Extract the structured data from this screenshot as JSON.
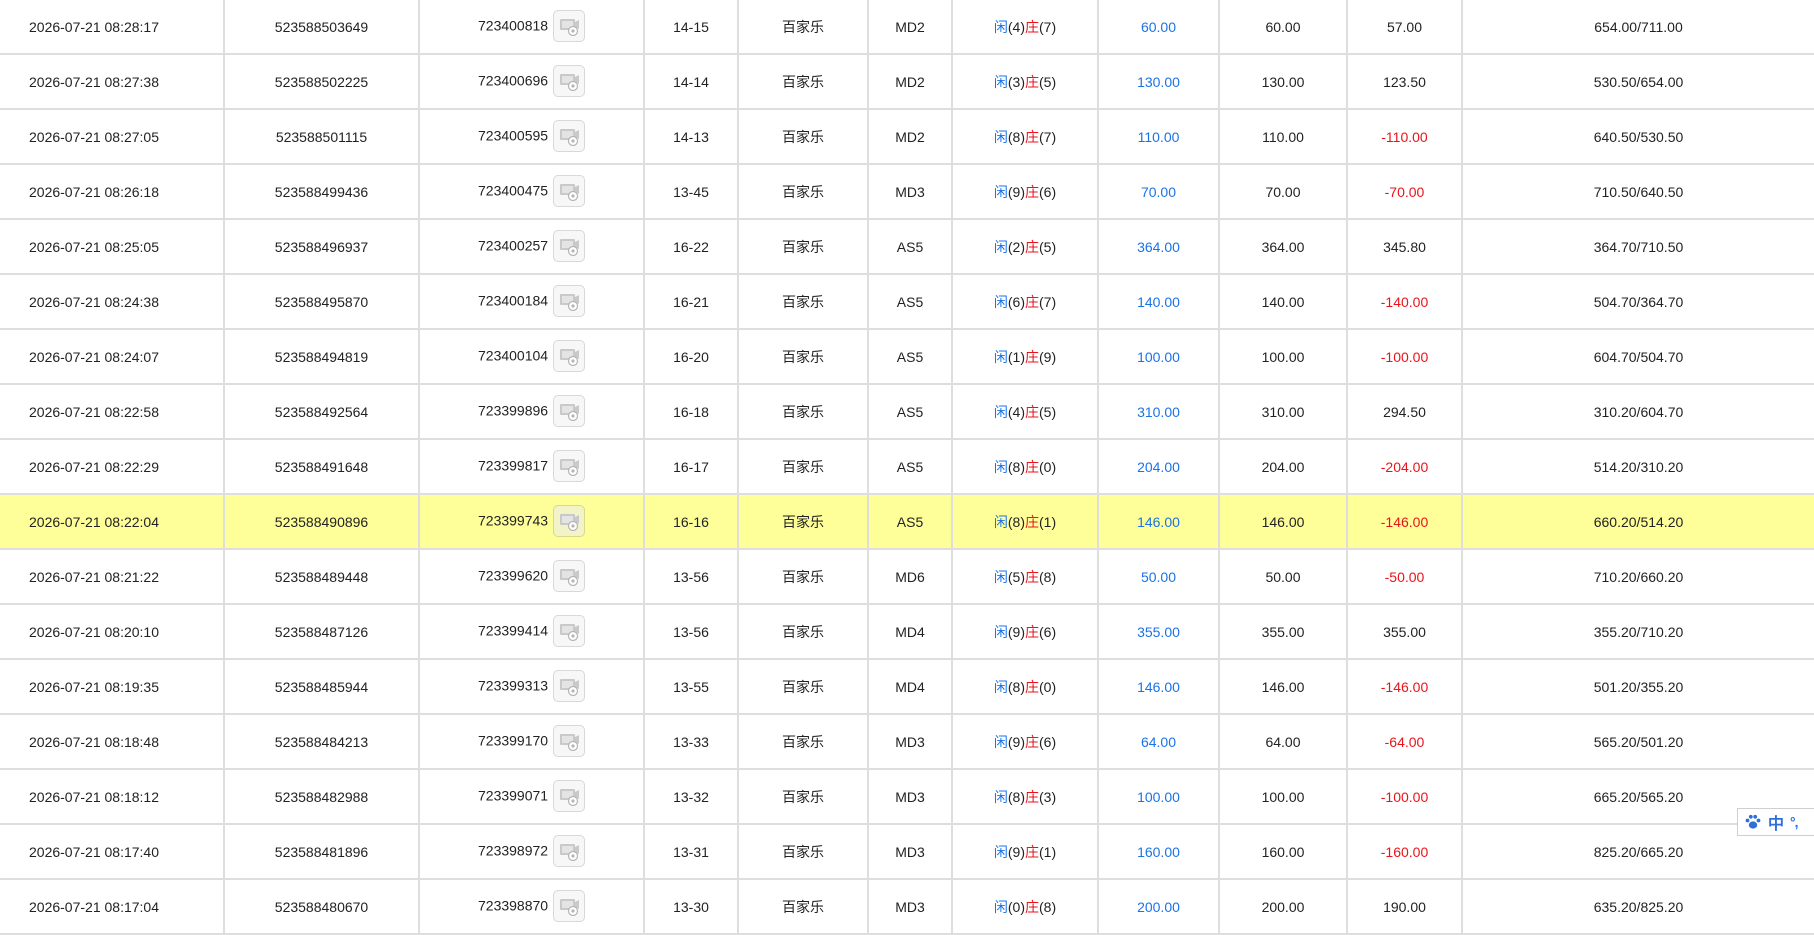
{
  "colors": {
    "accent_blue": "#1a73e8",
    "negative_red": "#e8141b",
    "highlight_row": "#ffff99",
    "grid_line": "#dedede"
  },
  "icons": {
    "video_replay": "video-replay-icon",
    "ime_paw": "paw-icon"
  },
  "labels": {
    "player": "闲",
    "banker": "庄"
  },
  "ime": {
    "lang": "中",
    "punct": "°,"
  },
  "rows": [
    {
      "time": "2026-07-21 08:28:17",
      "bet_id": "523588503649",
      "round": "723400818",
      "shoe": "14-15",
      "game": "百家乐",
      "table": "MD2",
      "p": "4",
      "b": "7",
      "bet": "60.00",
      "valid": "60.00",
      "result": "57.00",
      "sign": "pos",
      "balance": "654.00/711.00",
      "hl": false
    },
    {
      "time": "2026-07-21 08:27:38",
      "bet_id": "523588502225",
      "round": "723400696",
      "shoe": "14-14",
      "game": "百家乐",
      "table": "MD2",
      "p": "3",
      "b": "5",
      "bet": "130.00",
      "valid": "130.00",
      "result": "123.50",
      "sign": "pos",
      "balance": "530.50/654.00",
      "hl": false
    },
    {
      "time": "2026-07-21 08:27:05",
      "bet_id": "523588501115",
      "round": "723400595",
      "shoe": "14-13",
      "game": "百家乐",
      "table": "MD2",
      "p": "8",
      "b": "7",
      "bet": "110.00",
      "valid": "110.00",
      "result": "-110.00",
      "sign": "neg",
      "balance": "640.50/530.50",
      "hl": false
    },
    {
      "time": "2026-07-21 08:26:18",
      "bet_id": "523588499436",
      "round": "723400475",
      "shoe": "13-45",
      "game": "百家乐",
      "table": "MD3",
      "p": "9",
      "b": "6",
      "bet": "70.00",
      "valid": "70.00",
      "result": "-70.00",
      "sign": "neg",
      "balance": "710.50/640.50",
      "hl": false
    },
    {
      "time": "2026-07-21 08:25:05",
      "bet_id": "523588496937",
      "round": "723400257",
      "shoe": "16-22",
      "game": "百家乐",
      "table": "AS5",
      "p": "2",
      "b": "5",
      "bet": "364.00",
      "valid": "364.00",
      "result": "345.80",
      "sign": "pos",
      "balance": "364.70/710.50",
      "hl": false
    },
    {
      "time": "2026-07-21 08:24:38",
      "bet_id": "523588495870",
      "round": "723400184",
      "shoe": "16-21",
      "game": "百家乐",
      "table": "AS5",
      "p": "6",
      "b": "7",
      "bet": "140.00",
      "valid": "140.00",
      "result": "-140.00",
      "sign": "neg",
      "balance": "504.70/364.70",
      "hl": false
    },
    {
      "time": "2026-07-21 08:24:07",
      "bet_id": "523588494819",
      "round": "723400104",
      "shoe": "16-20",
      "game": "百家乐",
      "table": "AS5",
      "p": "1",
      "b": "9",
      "bet": "100.00",
      "valid": "100.00",
      "result": "-100.00",
      "sign": "neg",
      "balance": "604.70/504.70",
      "hl": false
    },
    {
      "time": "2026-07-21 08:22:58",
      "bet_id": "523588492564",
      "round": "723399896",
      "shoe": "16-18",
      "game": "百家乐",
      "table": "AS5",
      "p": "4",
      "b": "5",
      "bet": "310.00",
      "valid": "310.00",
      "result": "294.50",
      "sign": "pos",
      "balance": "310.20/604.70",
      "hl": false
    },
    {
      "time": "2026-07-21 08:22:29",
      "bet_id": "523588491648",
      "round": "723399817",
      "shoe": "16-17",
      "game": "百家乐",
      "table": "AS5",
      "p": "8",
      "b": "0",
      "bet": "204.00",
      "valid": "204.00",
      "result": "-204.00",
      "sign": "neg",
      "balance": "514.20/310.20",
      "hl": false
    },
    {
      "time": "2026-07-21 08:22:04",
      "bet_id": "523588490896",
      "round": "723399743",
      "shoe": "16-16",
      "game": "百家乐",
      "table": "AS5",
      "p": "8",
      "b": "1",
      "bet": "146.00",
      "valid": "146.00",
      "result": "-146.00",
      "sign": "neg",
      "balance": "660.20/514.20",
      "hl": true
    },
    {
      "time": "2026-07-21 08:21:22",
      "bet_id": "523588489448",
      "round": "723399620",
      "shoe": "13-56",
      "game": "百家乐",
      "table": "MD6",
      "p": "5",
      "b": "8",
      "bet": "50.00",
      "valid": "50.00",
      "result": "-50.00",
      "sign": "neg",
      "balance": "710.20/660.20",
      "hl": false
    },
    {
      "time": "2026-07-21 08:20:10",
      "bet_id": "523588487126",
      "round": "723399414",
      "shoe": "13-56",
      "game": "百家乐",
      "table": "MD4",
      "p": "9",
      "b": "6",
      "bet": "355.00",
      "valid": "355.00",
      "result": "355.00",
      "sign": "pos",
      "balance": "355.20/710.20",
      "hl": false
    },
    {
      "time": "2026-07-21 08:19:35",
      "bet_id": "523588485944",
      "round": "723399313",
      "shoe": "13-55",
      "game": "百家乐",
      "table": "MD4",
      "p": "8",
      "b": "0",
      "bet": "146.00",
      "valid": "146.00",
      "result": "-146.00",
      "sign": "neg",
      "balance": "501.20/355.20",
      "hl": false
    },
    {
      "time": "2026-07-21 08:18:48",
      "bet_id": "523588484213",
      "round": "723399170",
      "shoe": "13-33",
      "game": "百家乐",
      "table": "MD3",
      "p": "9",
      "b": "6",
      "bet": "64.00",
      "valid": "64.00",
      "result": "-64.00",
      "sign": "neg",
      "balance": "565.20/501.20",
      "hl": false
    },
    {
      "time": "2026-07-21 08:18:12",
      "bet_id": "523588482988",
      "round": "723399071",
      "shoe": "13-32",
      "game": "百家乐",
      "table": "MD3",
      "p": "8",
      "b": "3",
      "bet": "100.00",
      "valid": "100.00",
      "result": "-100.00",
      "sign": "neg",
      "balance": "665.20/565.20",
      "hl": false
    },
    {
      "time": "2026-07-21 08:17:40",
      "bet_id": "523588481896",
      "round": "723398972",
      "shoe": "13-31",
      "game": "百家乐",
      "table": "MD3",
      "p": "9",
      "b": "1",
      "bet": "160.00",
      "valid": "160.00",
      "result": "-160.00",
      "sign": "neg",
      "balance": "825.20/665.20",
      "hl": false
    },
    {
      "time": "2026-07-21 08:17:04",
      "bet_id": "523588480670",
      "round": "723398870",
      "shoe": "13-30",
      "game": "百家乐",
      "table": "MD3",
      "p": "0",
      "b": "8",
      "bet": "200.00",
      "valid": "200.00",
      "result": "190.00",
      "sign": "pos",
      "balance": "635.20/825.20",
      "hl": false
    }
  ]
}
